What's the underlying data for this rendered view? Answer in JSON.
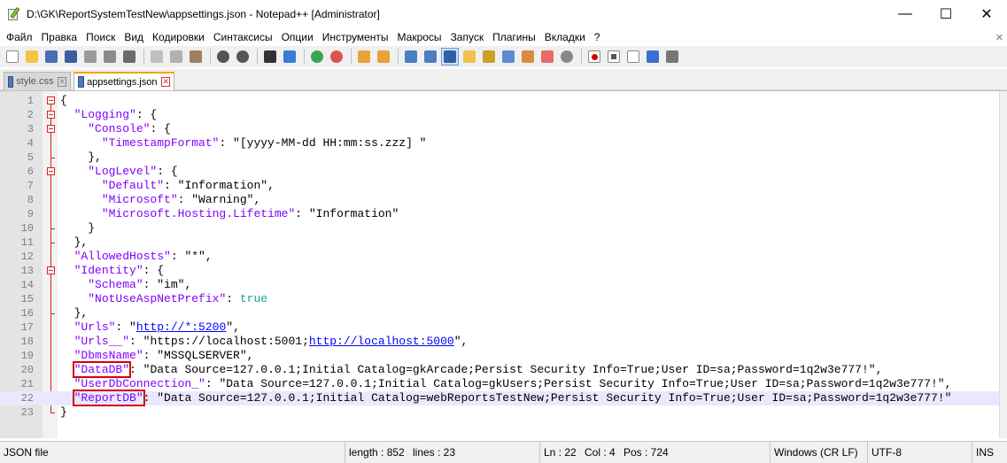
{
  "window": {
    "title": "D:\\GK\\ReportSystemTestNew\\appsettings.json - Notepad++ [Administrator]",
    "minimize": "—",
    "maximize": "☐",
    "close": "✕"
  },
  "menu": {
    "items": [
      "Файл",
      "Правка",
      "Поиск",
      "Вид",
      "Кодировки",
      "Синтаксисы",
      "Опции",
      "Инструменты",
      "Макросы",
      "Запуск",
      "Плагины",
      "Вкладки",
      "?"
    ],
    "close_glyph": "✕"
  },
  "toolbar": {
    "icons": [
      "new-file-icon",
      "open-file-icon",
      "save-icon",
      "save-all-icon",
      "close-icon",
      "close-all-icon",
      "print-icon",
      "cut-icon",
      "copy-icon",
      "paste-icon",
      "undo-icon",
      "redo-icon",
      "find-icon",
      "replace-icon",
      "zoom-in-icon",
      "zoom-out-icon",
      "sync-vertical-icon",
      "sync-horizontal-icon",
      "word-wrap-icon",
      "show-all-chars-icon",
      "indent-guide-icon",
      "lang-icon",
      "doc-map-icon",
      "function-list-icon",
      "folder-as-workspace-icon",
      "monitor-icon",
      "record-macro-icon",
      "stop-macro-icon",
      "play-macro-icon",
      "play-multiple-icon",
      "save-macro-icon"
    ]
  },
  "tabs": [
    {
      "label": "style.css",
      "active": false,
      "close": "✕"
    },
    {
      "label": "appsettings.json",
      "active": true,
      "close": "✕"
    }
  ],
  "editor": {
    "current_line": 22,
    "lines": [
      {
        "n": "1",
        "parts": [
          [
            "p",
            "{"
          ]
        ]
      },
      {
        "n": "2",
        "parts": [
          [
            "p",
            "  "
          ],
          [
            "k",
            "\"Logging\""
          ],
          [
            "p",
            ": {"
          ]
        ]
      },
      {
        "n": "3",
        "parts": [
          [
            "p",
            "    "
          ],
          [
            "k",
            "\"Console\""
          ],
          [
            "p",
            ": {"
          ]
        ]
      },
      {
        "n": "4",
        "parts": [
          [
            "p",
            "      "
          ],
          [
            "k",
            "\"TimestampFormat\""
          ],
          [
            "p",
            ": "
          ],
          [
            "s",
            "\"[yyyy-MM-dd HH:mm:ss.zzz] \""
          ]
        ]
      },
      {
        "n": "5",
        "parts": [
          [
            "p",
            "    },"
          ]
        ]
      },
      {
        "n": "6",
        "parts": [
          [
            "p",
            "    "
          ],
          [
            "k",
            "\"LogLevel\""
          ],
          [
            "p",
            ": {"
          ]
        ]
      },
      {
        "n": "7",
        "parts": [
          [
            "p",
            "      "
          ],
          [
            "k",
            "\"Default\""
          ],
          [
            "p",
            ": "
          ],
          [
            "s",
            "\"Information\""
          ],
          [
            "p",
            ","
          ]
        ]
      },
      {
        "n": "8",
        "parts": [
          [
            "p",
            "      "
          ],
          [
            "k",
            "\"Microsoft\""
          ],
          [
            "p",
            ": "
          ],
          [
            "s",
            "\"Warning\""
          ],
          [
            "p",
            ","
          ]
        ]
      },
      {
        "n": "9",
        "parts": [
          [
            "p",
            "      "
          ],
          [
            "k",
            "\"Microsoft.Hosting.Lifetime\""
          ],
          [
            "p",
            ": "
          ],
          [
            "s",
            "\"Information\""
          ]
        ]
      },
      {
        "n": "10",
        "parts": [
          [
            "p",
            "    }"
          ]
        ]
      },
      {
        "n": "11",
        "parts": [
          [
            "p",
            "  },"
          ]
        ]
      },
      {
        "n": "12",
        "parts": [
          [
            "p",
            "  "
          ],
          [
            "k",
            "\"AllowedHosts\""
          ],
          [
            "p",
            ": "
          ],
          [
            "s",
            "\"*\""
          ],
          [
            "p",
            ","
          ]
        ]
      },
      {
        "n": "13",
        "parts": [
          [
            "p",
            "  "
          ],
          [
            "k",
            "\"Identity\""
          ],
          [
            "p",
            ": {"
          ]
        ]
      },
      {
        "n": "14",
        "parts": [
          [
            "p",
            "    "
          ],
          [
            "k",
            "\"Schema\""
          ],
          [
            "p",
            ": "
          ],
          [
            "s",
            "\"im\""
          ],
          [
            "p",
            ","
          ]
        ]
      },
      {
        "n": "15",
        "parts": [
          [
            "p",
            "    "
          ],
          [
            "k",
            "\"NotUseAspNetPrefix\""
          ],
          [
            "p",
            ": "
          ],
          [
            "num",
            "true"
          ]
        ]
      },
      {
        "n": "16",
        "parts": [
          [
            "p",
            "  },"
          ]
        ]
      },
      {
        "n": "17",
        "parts": [
          [
            "p",
            "  "
          ],
          [
            "k",
            "\"Urls\""
          ],
          [
            "p",
            ": "
          ],
          [
            "s",
            "\""
          ],
          [
            "u",
            "http://*:5200"
          ],
          [
            "s",
            "\""
          ],
          [
            "p",
            ","
          ]
        ]
      },
      {
        "n": "18",
        "parts": [
          [
            "p",
            "  "
          ],
          [
            "k",
            "\"Urls__\""
          ],
          [
            "p",
            ": "
          ],
          [
            "s",
            "\"https://localhost:5001;"
          ],
          [
            "u",
            "http://localhost:5000"
          ],
          [
            "s",
            "\""
          ],
          [
            "p",
            ","
          ]
        ]
      },
      {
        "n": "19",
        "parts": [
          [
            "p",
            "  "
          ],
          [
            "k",
            "\"DbmsName\""
          ],
          [
            "p",
            ": "
          ],
          [
            "s",
            "\"MSSQLSERVER\""
          ],
          [
            "p",
            ","
          ]
        ]
      },
      {
        "n": "20",
        "parts": [
          [
            "p",
            "  "
          ],
          [
            "khl",
            "\"DataDB\""
          ],
          [
            "p",
            ": "
          ],
          [
            "s",
            "\"Data Source=127.0.0.1;Initial Catalog=gkArcade;Persist Security Info=True;User ID=sa;Password=1q2w3e777!\""
          ],
          [
            "p",
            ","
          ]
        ]
      },
      {
        "n": "21",
        "parts": [
          [
            "p",
            "  "
          ],
          [
            "k",
            "\"UserDbConnection_\""
          ],
          [
            "p",
            ": "
          ],
          [
            "s",
            "\"Data Source=127.0.0.1;Initial Catalog=gkUsers;Persist Security Info=True;User ID=sa;Password=1q2w3e777!\""
          ],
          [
            "p",
            ","
          ]
        ]
      },
      {
        "n": "22",
        "parts": [
          [
            "p",
            "  "
          ],
          [
            "khl",
            "\"ReportDB\""
          ],
          [
            "p",
            ": "
          ],
          [
            "s",
            "\"Data Source=127.0.0.1;Initial Catalog=webReportsTestNew;Persist Security Info=True;User ID=sa;Password=1q2w3e777!\""
          ]
        ]
      },
      {
        "n": "23",
        "parts": [
          [
            "p",
            "}"
          ]
        ]
      }
    ]
  },
  "status": {
    "file_type": "JSON file",
    "length": "length : 852",
    "lines": "lines : 23",
    "ln": "Ln : 22",
    "col": "Col : 4",
    "pos": "Pos : 724",
    "eol": "Windows (CR LF)",
    "encoding": "UTF-8",
    "mode": "INS"
  }
}
